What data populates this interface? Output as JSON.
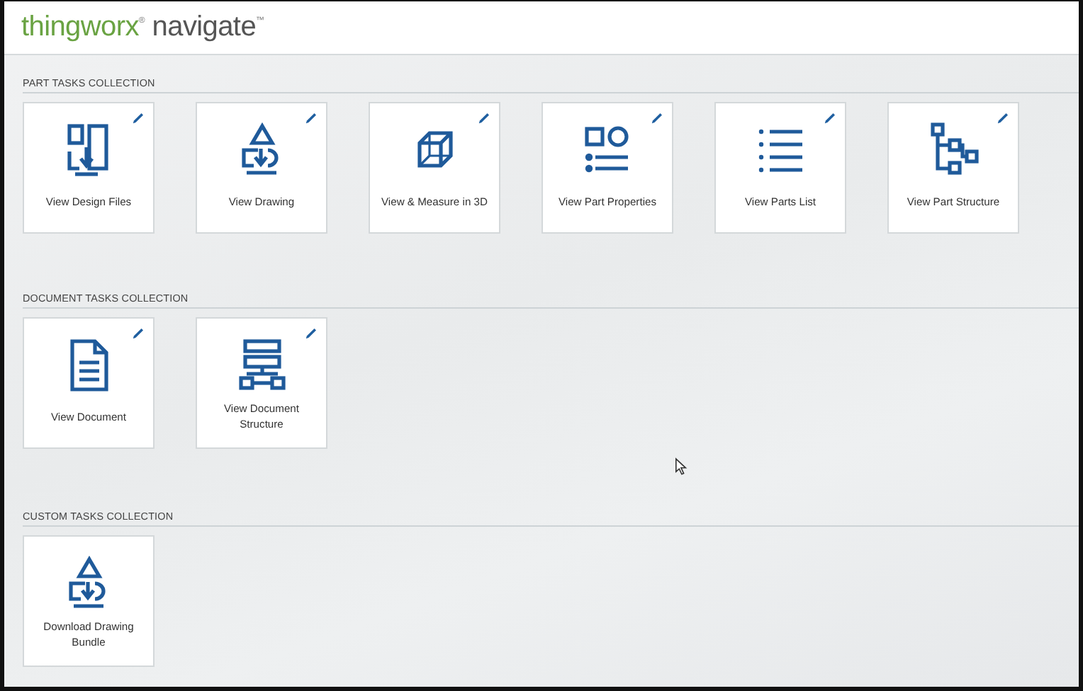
{
  "header": {
    "brand": "thingworx",
    "brand_mark": "®",
    "product": "navigate",
    "product_mark": "™"
  },
  "sections": [
    {
      "title": "PART TASKS COLLECTION",
      "tiles": [
        {
          "label": "View Design Files",
          "kind": "files",
          "editable": true
        },
        {
          "label": "View Drawing",
          "kind": "drawing",
          "editable": true
        },
        {
          "label": "View & Measure in 3D",
          "kind": "cube",
          "editable": true
        },
        {
          "label": "View Part Properties",
          "kind": "properties",
          "editable": true
        },
        {
          "label": "View Parts List",
          "kind": "list",
          "editable": true
        },
        {
          "label": "View Part Structure",
          "kind": "tree",
          "editable": true
        }
      ]
    },
    {
      "title": "DOCUMENT TASKS COLLECTION",
      "tiles": [
        {
          "label": "View Document",
          "kind": "document",
          "editable": true
        },
        {
          "label": "View Document Structure",
          "kind": "hierarchy",
          "editable": true
        }
      ]
    },
    {
      "title": "CUSTOM TASKS COLLECTION",
      "tiles": [
        {
          "label": "Download Drawing Bundle",
          "kind": "drawing",
          "editable": false
        }
      ]
    }
  ]
}
